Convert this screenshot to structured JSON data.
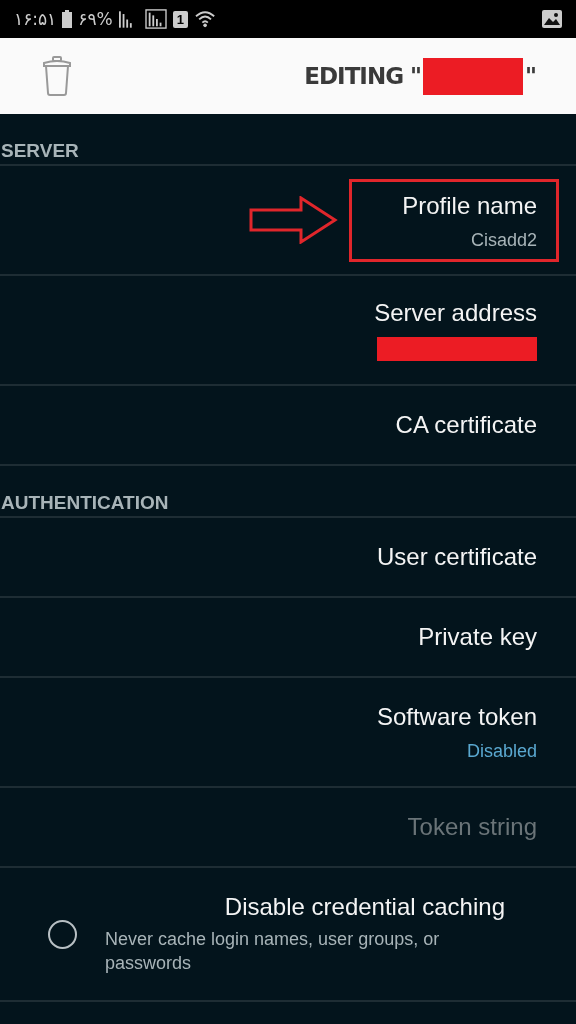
{
  "status_bar": {
    "time": "۱۶:۵۱",
    "battery": "۶۹%",
    "sim": "1"
  },
  "header": {
    "title_before": "EDITING \"",
    "title_redacted": true,
    "title_after": "\""
  },
  "sections": [
    {
      "title": "SERVER",
      "items": [
        {
          "kind": "entry",
          "title": "Profile name",
          "value": "Cisadd2",
          "accent": false,
          "highlighted": true,
          "disabled": false
        },
        {
          "kind": "entry",
          "title": "Server address",
          "value_redacted": true,
          "highlighted": false,
          "disabled": false
        },
        {
          "kind": "entry",
          "title": "CA certificate",
          "highlighted": false,
          "disabled": false
        }
      ]
    },
    {
      "title": "AUTHENTICATION",
      "items": [
        {
          "kind": "entry",
          "title": "User certificate",
          "highlighted": false,
          "disabled": false
        },
        {
          "kind": "entry",
          "title": "Private key",
          "highlighted": false,
          "disabled": false
        },
        {
          "kind": "entry",
          "title": "Software token",
          "value": "Disabled",
          "accent": true,
          "highlighted": false,
          "disabled": false
        },
        {
          "kind": "entry",
          "title": "Token string",
          "highlighted": false,
          "disabled": true
        },
        {
          "kind": "check",
          "title": "Disable credential caching",
          "summary": "Never cache login names, user groups, or passwords",
          "checked": false
        }
      ]
    }
  ]
}
